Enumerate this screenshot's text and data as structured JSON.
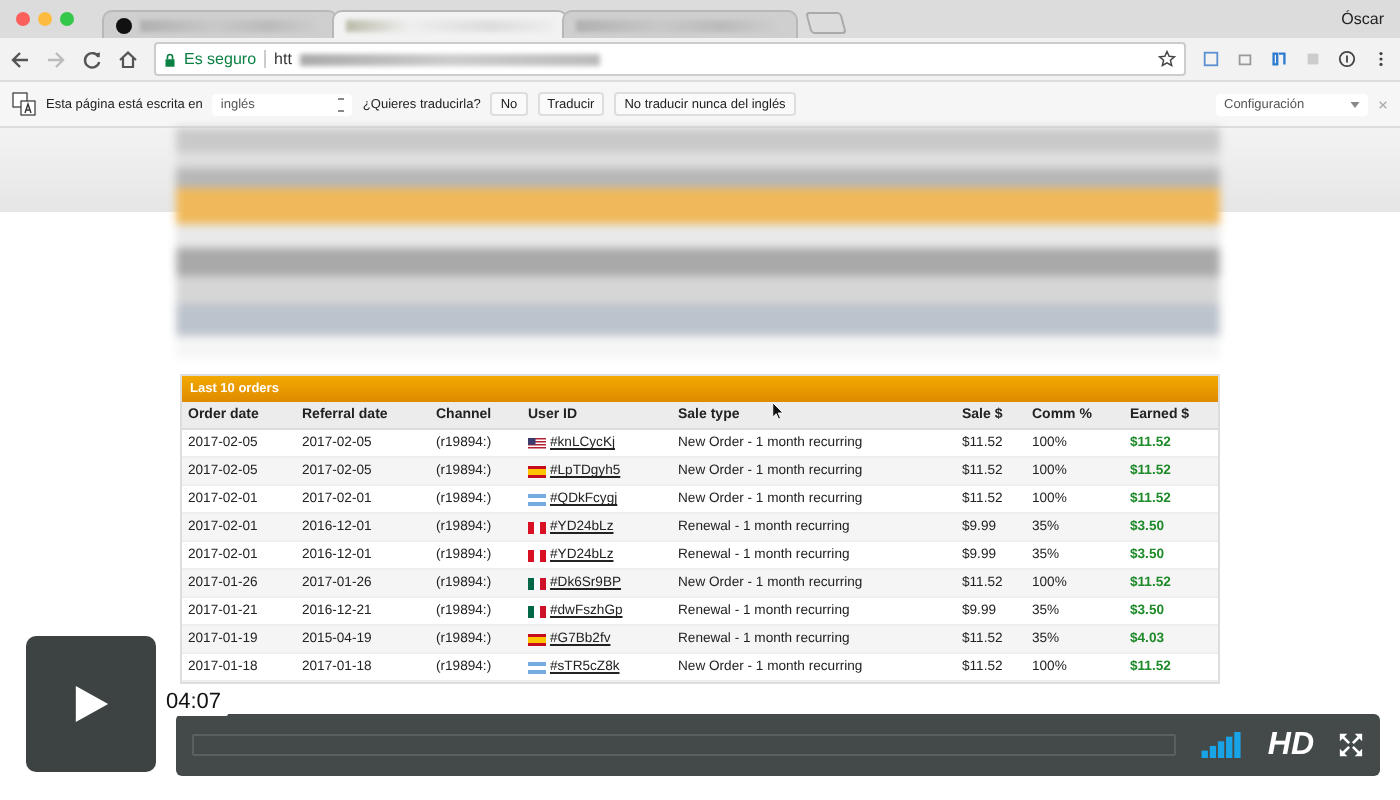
{
  "window": {
    "user": "Óscar",
    "tabs": [
      {
        "selected": false
      },
      {
        "selected": true
      },
      {
        "selected": false
      }
    ]
  },
  "toolbar": {
    "security": "Es seguro",
    "url": "htt"
  },
  "translate_bar": {
    "message": "Esta página está escrita en",
    "language": "inglés",
    "question": "¿Quieres traducirla?",
    "buttons": [
      "No",
      "Traducir",
      "No traducir nunca del inglés"
    ],
    "settings": "Configuración"
  },
  "orders": {
    "title": "Last 10 orders",
    "columns": [
      "Order date",
      "Referral date",
      "Channel",
      "User ID",
      "Sale type",
      "Sale $",
      "Comm %",
      "Earned $"
    ],
    "rows": [
      {
        "order_date": "2017-02-05",
        "referral_date": "2017-02-05",
        "channel": "(r19894:)",
        "kind": "us",
        "user_id": "#knLCycKj",
        "sale_type": "New Order - 1 month recurring",
        "sale": "$11.52",
        "comm": "100%",
        "earned": "$11.52"
      },
      {
        "order_date": "2017-02-05",
        "referral_date": "2017-02-05",
        "channel": "(r19894:)",
        "kind": "es",
        "user_id": "#LpTDgyh5",
        "sale_type": "New Order - 1 month recurring",
        "sale": "$11.52",
        "comm": "100%",
        "earned": "$11.52"
      },
      {
        "order_date": "2017-02-01",
        "referral_date": "2017-02-01",
        "channel": "(r19894:)",
        "kind": "ar",
        "user_id": "#QDkFcygj",
        "sale_type": "New Order - 1 month recurring",
        "sale": "$11.52",
        "comm": "100%",
        "earned": "$11.52"
      },
      {
        "order_date": "2017-02-01",
        "referral_date": "2016-12-01",
        "channel": "(r19894:)",
        "kind": "pe",
        "user_id": "#YD24bLz",
        "sale_type": "Renewal - 1 month recurring",
        "sale": "$9.99",
        "comm": "35%",
        "earned": "$3.50"
      },
      {
        "order_date": "2017-02-01",
        "referral_date": "2016-12-01",
        "channel": "(r19894:)",
        "kind": "pe",
        "user_id": "#YD24bLz",
        "sale_type": "Renewal - 1 month recurring",
        "sale": "$9.99",
        "comm": "35%",
        "earned": "$3.50"
      },
      {
        "order_date": "2017-01-26",
        "referral_date": "2017-01-26",
        "channel": "(r19894:)",
        "kind": "mx",
        "user_id": "#Dk6Sr9BP",
        "sale_type": "New Order - 1 month recurring",
        "sale": "$11.52",
        "comm": "100%",
        "earned": "$11.52"
      },
      {
        "order_date": "2017-01-21",
        "referral_date": "2016-12-21",
        "channel": "(r19894:)",
        "kind": "mx",
        "user_id": "#dwFszhGp",
        "sale_type": "Renewal - 1 month recurring",
        "sale": "$9.99",
        "comm": "35%",
        "earned": "$3.50"
      },
      {
        "order_date": "2017-01-19",
        "referral_date": "2015-04-19",
        "channel": "(r19894:)",
        "kind": "es",
        "user_id": "#G7Bb2fv",
        "sale_type": "Renewal - 1 month recurring",
        "sale": "$11.52",
        "comm": "35%",
        "earned": "$4.03"
      },
      {
        "order_date": "2017-01-18",
        "referral_date": "2017-01-18",
        "channel": "(r19894:)",
        "kind": "ar",
        "user_id": "#sTR5cZ8k",
        "sale_type": "New Order - 1 month recurring",
        "sale": "$11.52",
        "comm": "100%",
        "earned": "$11.52"
      }
    ]
  },
  "player": {
    "time": "04:07",
    "quality": "HD"
  }
}
